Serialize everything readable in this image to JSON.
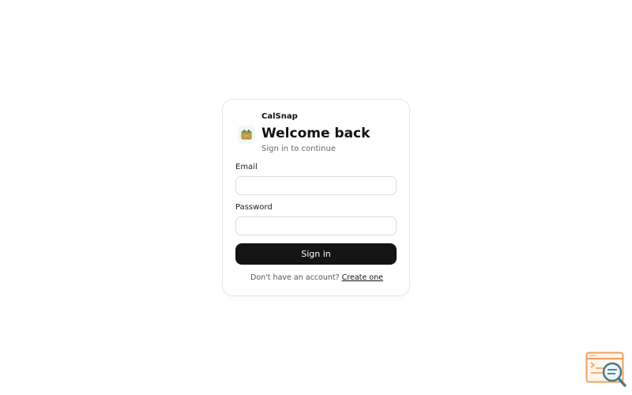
{
  "app": {
    "name": "CalSnap"
  },
  "login": {
    "title": "Welcome back",
    "subtitle": "Sign in to continue",
    "email_label": "Email",
    "email_value": "",
    "password_label": "Password",
    "password_value": "",
    "submit_label": "Sign in",
    "footer_text": "Don't have an account?",
    "footer_link": "Create one"
  },
  "icons": {
    "logo": "app-logo-icon",
    "corner": "search-window-icon"
  },
  "colors": {
    "button_bg": "#141414",
    "button_text": "#ffffff",
    "card_border": "#e6e6e6",
    "corner_icon_accent": "#f0a060",
    "corner_icon_lens": "#4a7a8c"
  }
}
